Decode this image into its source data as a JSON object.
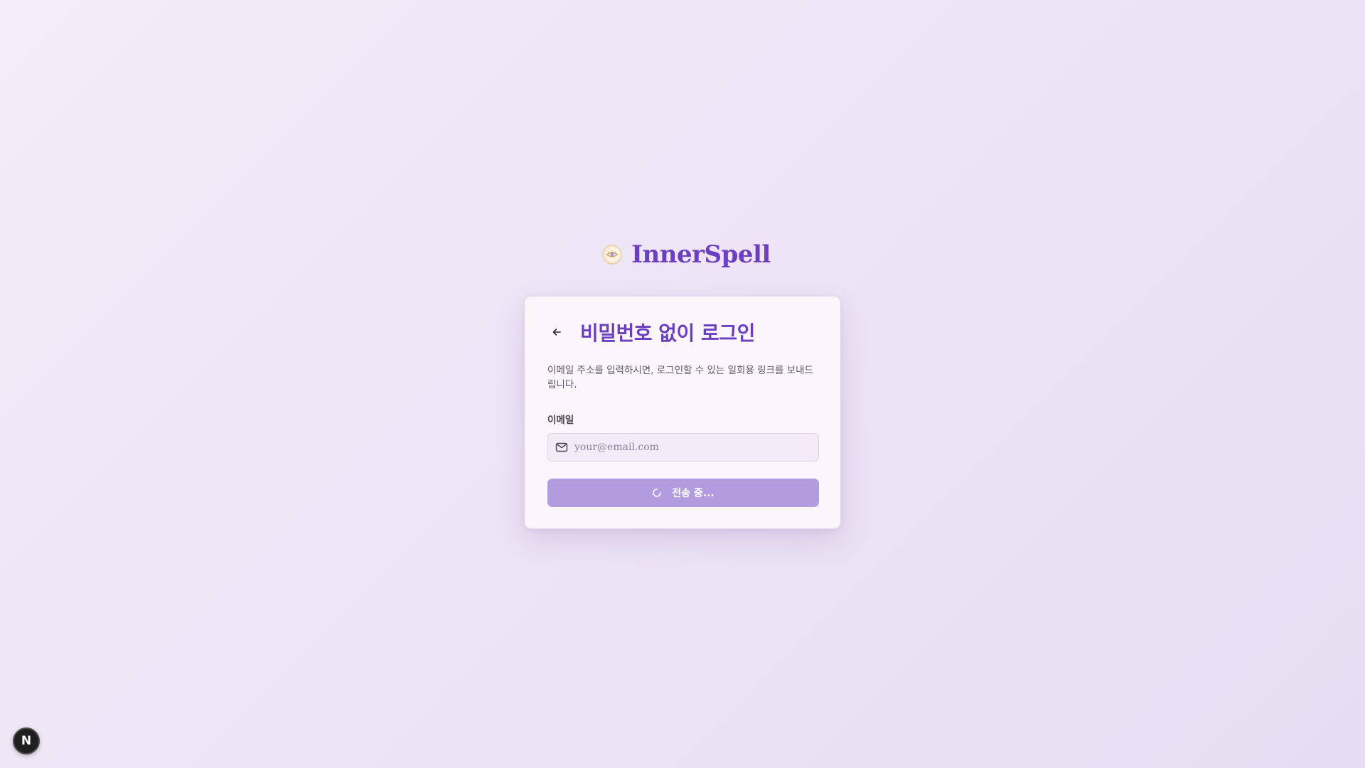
{
  "brand": {
    "name": "InnerSpell",
    "logo_icon": "mystic-eye-icon",
    "color": "#6b3fc0"
  },
  "card": {
    "back_icon": "arrow-left-icon",
    "title": "비밀번호 없이 로그인",
    "description": "이메일 주소를 입력하시면, 로그인할 수 있는 일회용 링크를 보내드립니다.",
    "email_label": "이메일",
    "email_icon": "mail-icon",
    "email_placeholder": "your@email.com",
    "email_value": "",
    "submit_label": "전송 중...",
    "submit_icon": "spinner-icon",
    "submit_color": "#b39be0"
  },
  "devtools": {
    "badge_label": "N"
  }
}
